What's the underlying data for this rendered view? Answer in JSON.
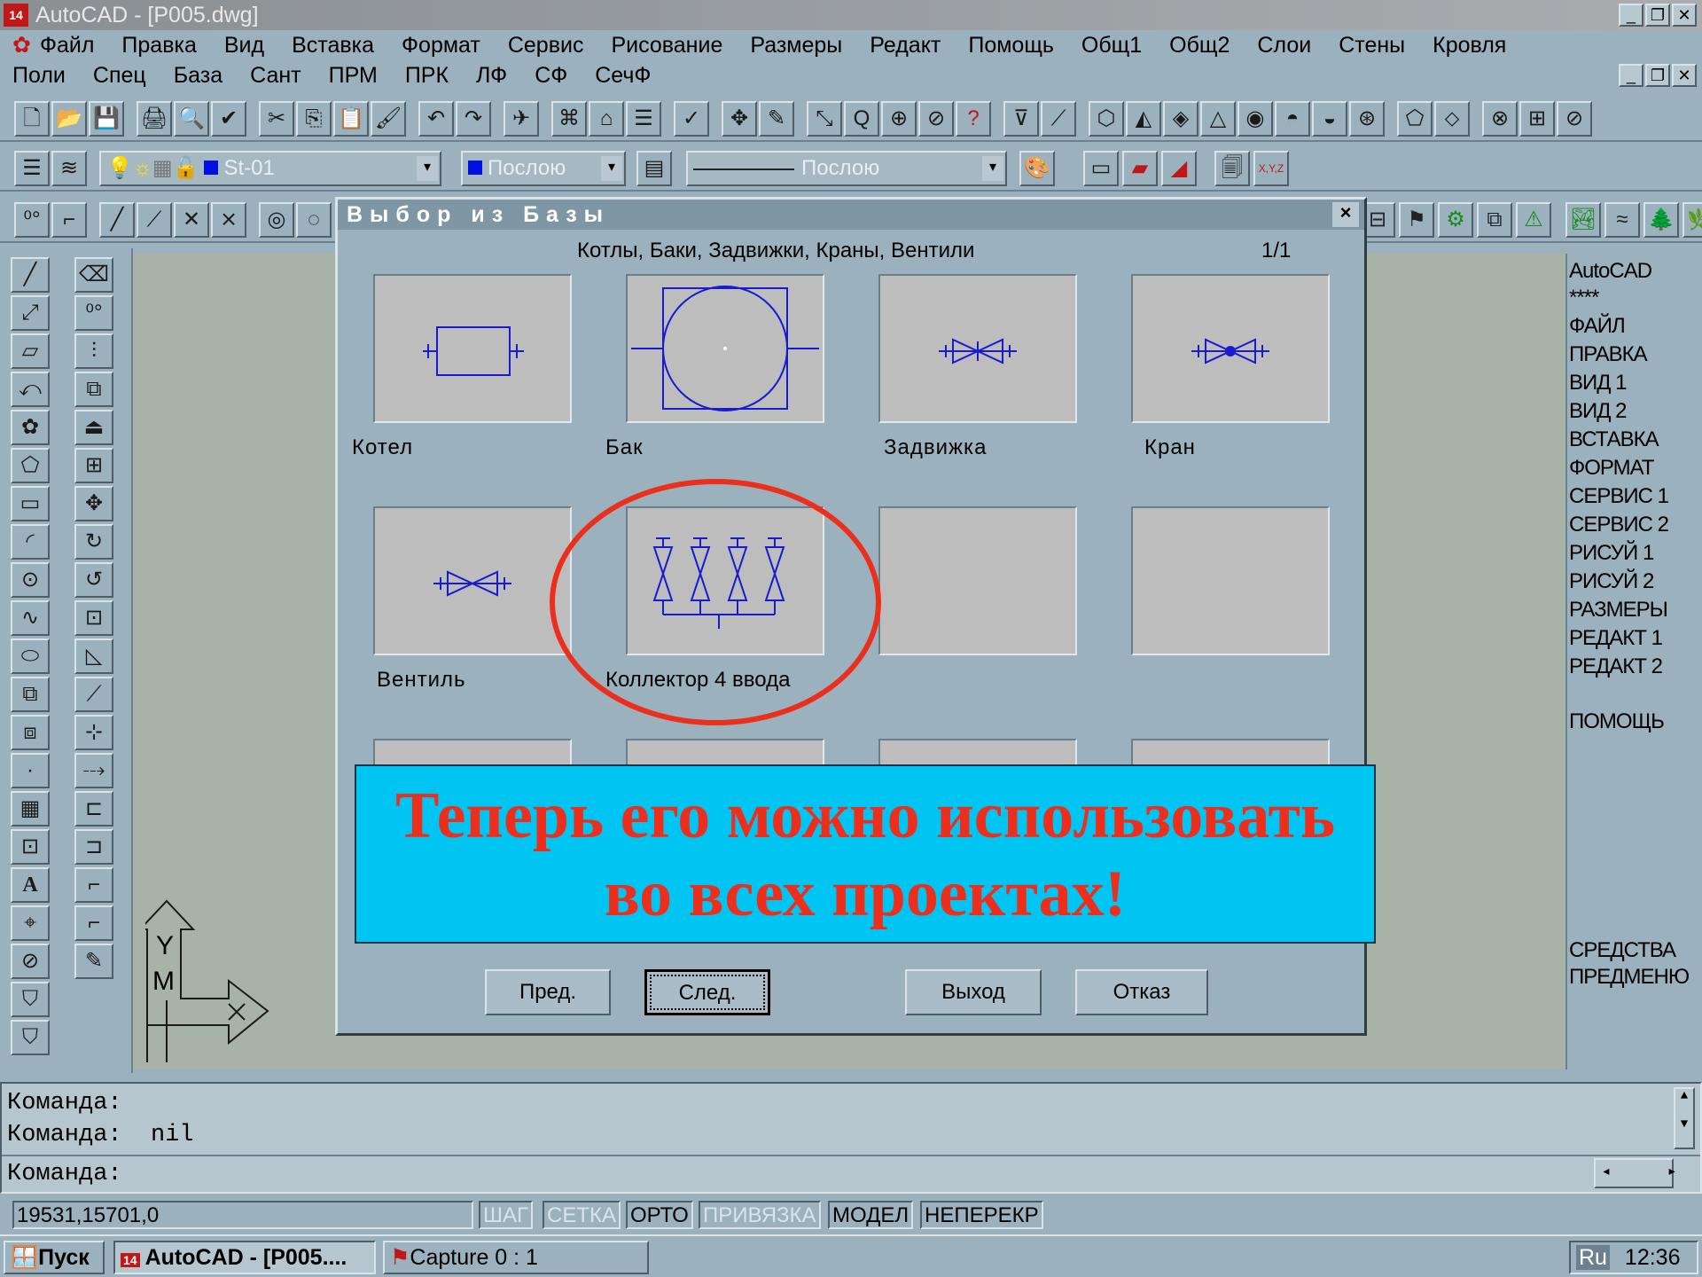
{
  "window": {
    "title": "AutoCAD - [P005.dwg]",
    "icon_label": "14"
  },
  "menubar1": [
    "Файл",
    "Правка",
    "Вид",
    "Вставка",
    "Формат",
    "Сервис",
    "Рисование",
    "Размеры",
    "Редакт",
    "Помощь",
    "Общ1",
    "Общ2",
    "Слои",
    "Стены",
    "Кровля"
  ],
  "menubar2": [
    "Поли",
    "Спец",
    "База",
    "Сант",
    "ПРМ",
    "ПРК",
    "ЛФ",
    "СФ",
    "СечФ"
  ],
  "layer_toolbar": {
    "layer": "St-01",
    "color": "Послою",
    "linetype": "Послою"
  },
  "dialog": {
    "title": "Выбор из Базы",
    "close": "×",
    "category": "Котлы, Баки, Задвижки, Краны, Вентили",
    "page": "1/1",
    "items": [
      "Котел",
      "Бак",
      "Задвижка",
      "Кран",
      "Вентиль",
      "Коллектор 4 ввода",
      "",
      "",
      "",
      "",
      "",
      ""
    ],
    "buttons": {
      "prev": "Пред.",
      "next": "След.",
      "exit": "Выход",
      "cancel": "Отказ"
    }
  },
  "banner": {
    "line1": "Теперь его можно использовать",
    "line2": "во всех проектах!"
  },
  "ucs": {
    "y": "Y",
    "m": "M"
  },
  "side_menu": [
    "AutoCAD",
    "****",
    "ФАЙЛ",
    "ПРАВКА",
    "ВИД 1",
    "ВИД 2",
    "ВСТАВКА",
    "ФОРМАТ",
    "СЕРВИС 1",
    "СЕРВИС 2",
    "РИСУЙ 1",
    "РИСУЙ 2",
    "РАЗМЕРЫ",
    "РЕДАКТ 1",
    "РЕДАКТ 2",
    "ПОМОЩЬ",
    "СРЕДСТВА",
    "ПРЕДМЕНЮ"
  ],
  "command_lines": [
    "Команда:",
    "Команда:  nil",
    "Команда:"
  ],
  "status": {
    "coords": "19531,15701,0",
    "snap": "ШАГ",
    "grid": "СЕТКА",
    "ortho": "ОРТО",
    "osnap": "ПРИВЯЗКА",
    "model": "МОДЕЛ",
    "tile": "НЕПЕРЕКР"
  },
  "taskbar": {
    "start": "Пуск",
    "task1": "AutoCAD - [P005....",
    "task2": "Capture 0 : 1",
    "lang": "Ru",
    "clock": "12:36"
  },
  "colors": {
    "highlight": "#ec2f1c",
    "banner_bg": "#00c5f3",
    "symbol": "#1a1ad0"
  }
}
